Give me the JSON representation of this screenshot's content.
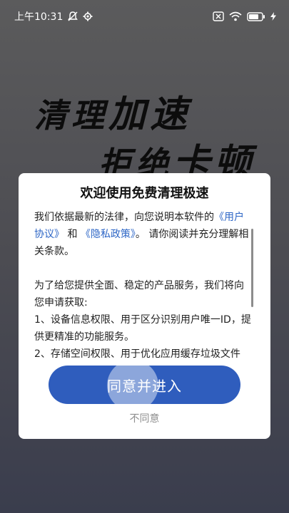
{
  "status_bar": {
    "time": "上午10:31",
    "icons_left": [
      "mute-icon",
      "settings-icon"
    ],
    "icons_right": [
      "no-sim-icon",
      "wifi-icon",
      "battery-icon",
      "charging-icon"
    ]
  },
  "splash": {
    "line1_a": "清理",
    "line1_b": "加速",
    "line2_a": "拒绝",
    "line2_b": "卡顿"
  },
  "dialog": {
    "title": "欢迎使用免费清理极速",
    "p1_before": "我们依据最新的法律，向您说明本软件的",
    "user_agreement": "《用户协议》",
    "and": "和",
    "privacy_policy": "《隐私政策》",
    "p1_after": "。 请你阅读并充分理解相关条款。",
    "p2": "为了给您提供全面、稳定的产品服务，我们将向您申请获取:",
    "p3": "1、设备信息权限、用于区分识别用户唯一ID，提供更精准的功能服务。",
    "p4": "2、存储空间权限、用于优化应用缓存垃圾文件",
    "agree": "同意并进入",
    "disagree": "不同意"
  },
  "colors": {
    "link": "#2d66c6",
    "button": "#2f5dbd"
  }
}
